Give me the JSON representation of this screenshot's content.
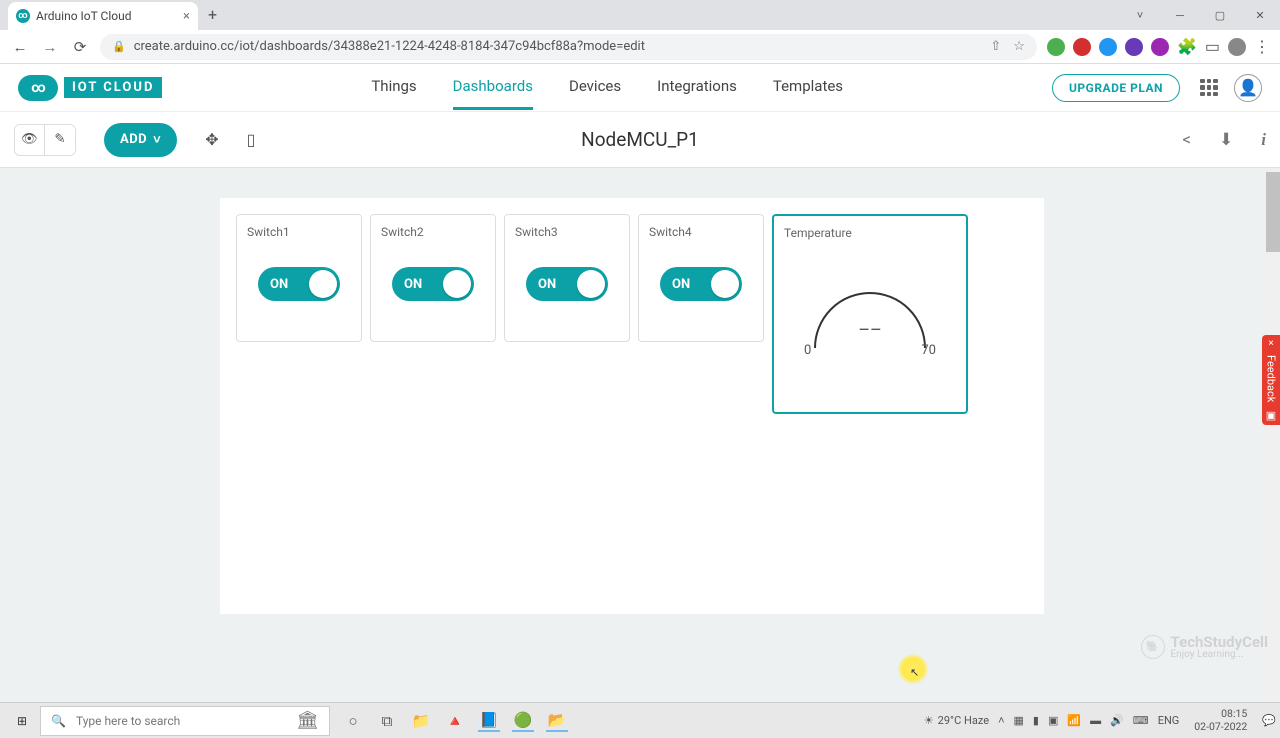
{
  "browser": {
    "tab_title": "Arduino IoT Cloud",
    "url": "create.arduino.cc/iot/dashboards/34388e21-1224-4248-8184-347c94bcf88a?mode=edit"
  },
  "header": {
    "logo_text": "IOT CLOUD",
    "nav": [
      "Things",
      "Dashboards",
      "Devices",
      "Integrations",
      "Templates"
    ],
    "active_nav": "Dashboards",
    "upgrade_label": "UPGRADE PLAN"
  },
  "toolbar": {
    "add_label": "ADD",
    "dashboard_title": "NodeMCU_P1"
  },
  "widgets": {
    "switches": [
      {
        "title": "Switch1",
        "state_label": "ON",
        "on": true
      },
      {
        "title": "Switch2",
        "state_label": "ON",
        "on": true
      },
      {
        "title": "Switch3",
        "state_label": "ON",
        "on": true
      },
      {
        "title": "Switch4",
        "state_label": "ON",
        "on": true
      }
    ],
    "temperature": {
      "title": "Temperature",
      "value_display": "––",
      "min": "0",
      "max": "70"
    }
  },
  "feedback_label": "Feedback",
  "watermark": {
    "name": "TechStudyCell",
    "sub": "Enjoy Learning..."
  },
  "taskbar": {
    "search_placeholder": "Type here to search",
    "weather": "29°C  Haze",
    "lang": "ENG",
    "time": "08:15",
    "date": "02-07-2022"
  }
}
